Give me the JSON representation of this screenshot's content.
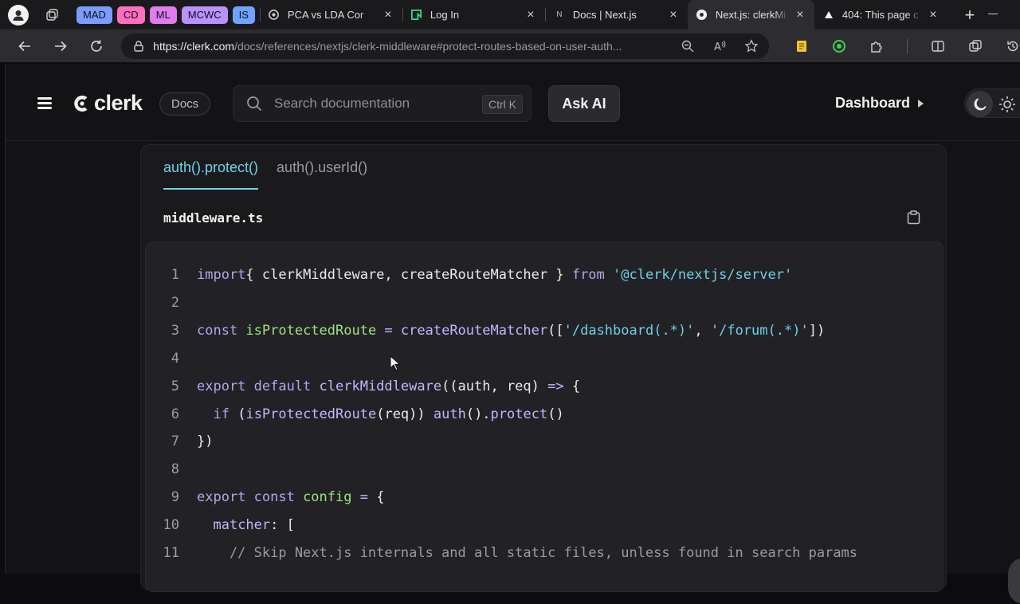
{
  "browser": {
    "tab_groups": [
      {
        "label": "MAD",
        "color": "#7a9cff"
      },
      {
        "label": "CD",
        "color": "#ff6ec0"
      },
      {
        "label": "ML",
        "color": "#e07cf0"
      },
      {
        "label": "MCWC",
        "color": "#b992ff"
      },
      {
        "label": "IS",
        "color": "#6fa3ff"
      }
    ],
    "tabs": [
      {
        "title": "PCA vs LDA Cor",
        "icon": "openai-icon"
      },
      {
        "title": "Log In",
        "icon": "neon-icon"
      },
      {
        "title": "Docs | Next.js",
        "icon": "nextjs-icon"
      },
      {
        "title": "Next.js: clerkMi",
        "icon": "clerk-icon",
        "active": true
      },
      {
        "title": "404: This page c",
        "icon": "vercel-icon"
      }
    ],
    "url_host": "https://clerk.com",
    "url_path": "/docs/references/nextjs/clerk-middleware#protect-routes-based-on-user-auth..."
  },
  "nav": {
    "logo": "clerk",
    "docs_badge": "Docs",
    "search_placeholder": "Search documentation",
    "search_shortcut": "Ctrl K",
    "ask_ai": "Ask AI",
    "dashboard": "Dashboard"
  },
  "code_card": {
    "tabs": [
      "auth().protect()",
      "auth().userId()"
    ],
    "active_tab": 0,
    "filename": "middleware.ts",
    "line_numbers": [
      "1",
      "2",
      "3",
      "4",
      "5",
      "6",
      "7",
      "8",
      "9",
      "10",
      "11"
    ],
    "lines": [
      [
        [
          "kw",
          "import"
        ],
        [
          "",
          "{ clerkMiddleware, createRouteMatcher }"
        ],
        [
          "kw",
          " from "
        ],
        [
          "str",
          "'@clerk/nextjs/server'"
        ]
      ],
      [],
      [
        [
          "kw",
          "const "
        ],
        [
          "var",
          "isProtectedRoute"
        ],
        [
          "op",
          " = "
        ],
        [
          "fn",
          "createRouteMatcher"
        ],
        [
          "",
          "(["
        ],
        [
          "str",
          "'/dashboard(.*)'"
        ],
        [
          "",
          ", "
        ],
        [
          "str",
          "'/forum(.*)'"
        ],
        [
          "",
          "])"
        ]
      ],
      [],
      [
        [
          "kw",
          "export default "
        ],
        [
          "fn",
          "clerkMiddleware"
        ],
        [
          "",
          "((auth, req) "
        ],
        [
          "op",
          "=>"
        ],
        [
          "",
          " {"
        ]
      ],
      [
        [
          "",
          "  "
        ],
        [
          "kw",
          "if"
        ],
        [
          "",
          " ("
        ],
        [
          "fn",
          "isProtectedRoute"
        ],
        [
          "",
          "(req)) "
        ],
        [
          "fn",
          "auth"
        ],
        [
          "",
          "()."
        ],
        [
          "fn",
          "protect"
        ],
        [
          "",
          "()"
        ]
      ],
      [
        [
          "",
          "})"
        ]
      ],
      [],
      [
        [
          "kw",
          "export const "
        ],
        [
          "var",
          "config"
        ],
        [
          "op",
          " = "
        ],
        [
          "",
          "{"
        ]
      ],
      [
        [
          "",
          "  "
        ],
        [
          "fn",
          "matcher"
        ],
        [
          "",
          ": ["
        ]
      ],
      [
        [
          "cmt",
          "    // Skip Next.js internals and all static files, unless found in search params"
        ]
      ]
    ]
  }
}
